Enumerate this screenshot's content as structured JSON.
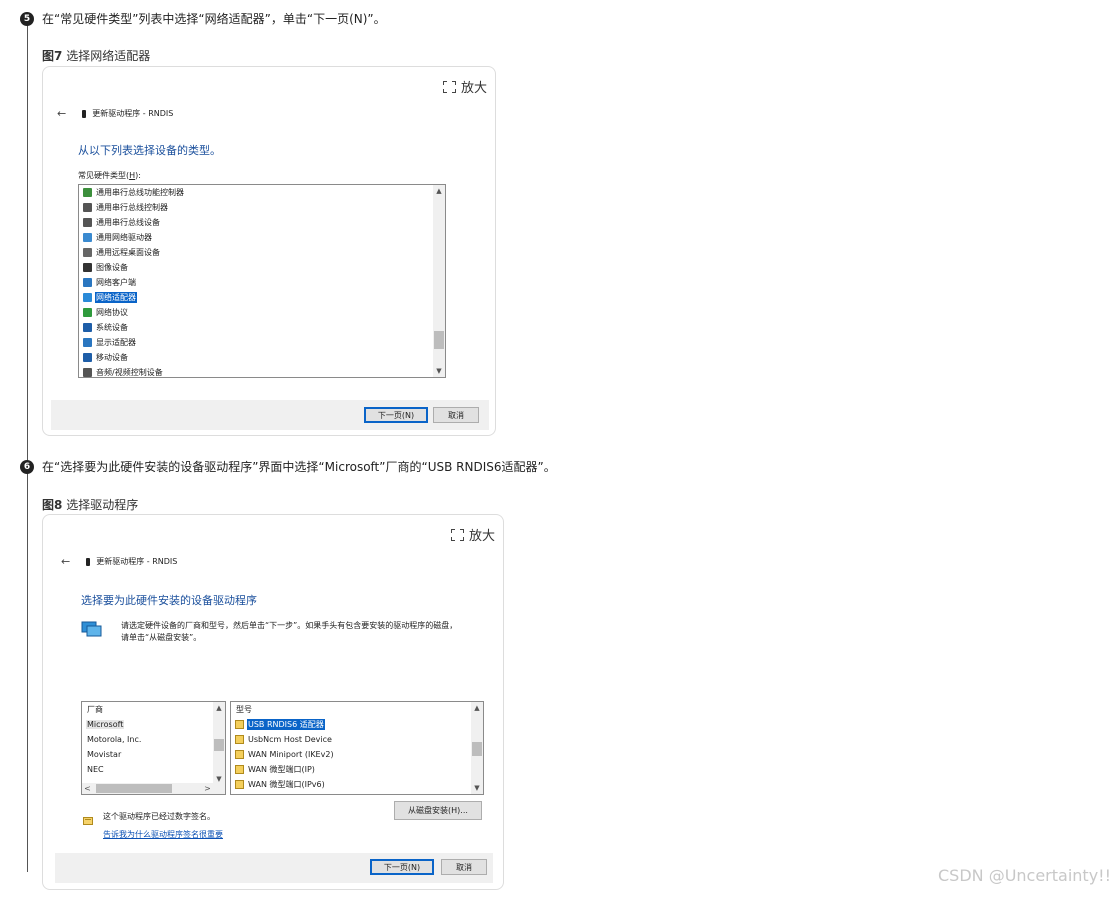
{
  "steps": [
    {
      "number": "5",
      "text": "在“常见硬件类型”列表中选择“网络适配器”，单击“下一页(N)”。",
      "figure_label": "图7",
      "figure_title": "选择网络适配器",
      "zoom_label": "放大",
      "window": {
        "header": "更新驱动程序 - RNDIS",
        "heading": "从以下列表选择设备的类型。",
        "list_label": "常见硬件类型(",
        "list_label_key": "H",
        "list_label_end": "):",
        "items": [
          {
            "label": "通用串行总线功能控制器",
            "icon": "usb-function-icon"
          },
          {
            "label": "通用串行总线控制器",
            "icon": "usb-icon"
          },
          {
            "label": "通用串行总线设备",
            "icon": "usb-icon"
          },
          {
            "label": "通用网络驱动器",
            "icon": "network-drive-icon"
          },
          {
            "label": "通用远程桌面设备",
            "icon": "remote-desktop-icon"
          },
          {
            "label": "图像设备",
            "icon": "imaging-icon"
          },
          {
            "label": "网络客户端",
            "icon": "network-client-icon"
          },
          {
            "label": "网络适配器",
            "icon": "network-adapter-icon",
            "selected": true
          },
          {
            "label": "网络协议",
            "icon": "network-protocol-icon"
          },
          {
            "label": "系统设备",
            "icon": "system-device-icon"
          },
          {
            "label": "显示适配器",
            "icon": "display-adapter-icon"
          },
          {
            "label": "移动设备",
            "icon": "mobile-device-icon"
          },
          {
            "label": "音频/视频控制设备",
            "icon": "audio-icon"
          }
        ],
        "next_button": "下一页(N)",
        "cancel_button": "取消"
      }
    },
    {
      "number": "6",
      "text": "在“选择要为此硬件安装的设备驱动程序”界面中选择“Microsoft”厂商的“USB RNDIS6适配器”。",
      "figure_label": "图8",
      "figure_title": "选择驱动程序",
      "zoom_label": "放大",
      "window": {
        "header": "更新驱动程序 - RNDIS",
        "heading": "选择要为此硬件安装的设备驱动程序",
        "description_line1": "请选定硬件设备的厂商和型号，然后单击“下一步”。如果手头有包含要安装的驱动程序的磁盘，",
        "description_line2": "请单击“从磁盘安装”。",
        "vendor_header": "厂商",
        "vendors": [
          {
            "label": "Microsoft",
            "selected": true
          },
          {
            "label": "Motorola, Inc."
          },
          {
            "label": "Movistar"
          },
          {
            "label": "NEC"
          }
        ],
        "model_header": "型号",
        "models": [
          {
            "label": "USB RNDIS6 适配器",
            "selected": true
          },
          {
            "label": "UsbNcm Host Device"
          },
          {
            "label": "WAN Miniport (IKEv2)"
          },
          {
            "label": "WAN 微型端口(IP)"
          },
          {
            "label": "WAN 微型端口(IPv6)"
          }
        ],
        "signed_note": "这个驱动程序已经过数字签名。",
        "signing_link": "告诉我为什么驱动程序签名很重要",
        "have_disk_button": "从磁盘安装(H)...",
        "next_button": "下一页(N)",
        "cancel_button": "取消"
      }
    }
  ],
  "watermark": "CSDN @Uncertainty!!"
}
